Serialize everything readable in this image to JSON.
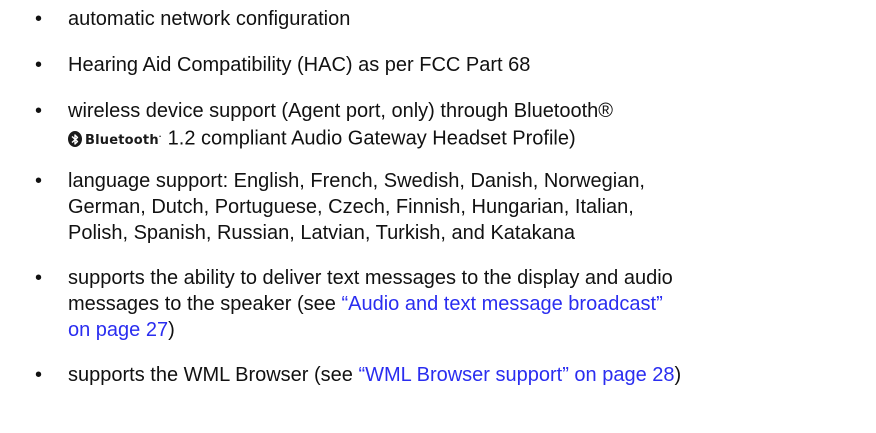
{
  "bullet_glyph": "•",
  "colors": {
    "text": "#111111",
    "link": "#2a2df0"
  },
  "items": [
    {
      "text": "automatic network configuration"
    },
    {
      "text": "Hearing Aid Compatibility (HAC) as per FCC Part 68"
    },
    {
      "line1": "wireless device support (Agent port, only) through Bluetooth®",
      "logo_text": "Bluetooth",
      "logo_icon": "bluetooth-logo",
      "line2": "1.2 compliant Audio Gateway Headset Profile)"
    },
    {
      "lines": [
        "language support: English, French, Swedish, Danish, Norwegian,",
        "German, Dutch, Portuguese, Czech, Finnish, Hungarian, Italian,",
        "Polish, Spanish, Russian, Latvian, Turkish, and Katakana"
      ]
    },
    {
      "line1": "supports the ability to deliver text messages to the display and audio",
      "line2_prefix": "messages to the speaker (see ",
      "link_part1": "“Audio and text message broadcast”",
      "link_part2": "on page 27",
      "line3_suffix": ")"
    },
    {
      "prefix": "supports the WML Browser (see ",
      "link": "“WML Browser support” on page 28",
      "suffix": ")"
    }
  ]
}
